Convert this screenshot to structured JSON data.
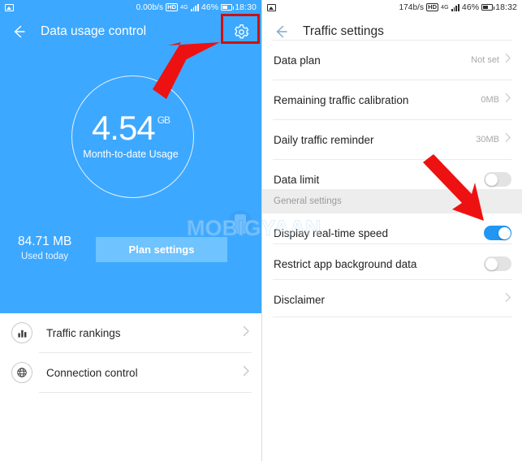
{
  "left": {
    "status": {
      "photo_icon": "photo-icon",
      "speed": "0.00b/s",
      "hd": "HD",
      "net": "4G",
      "battery_pct": "46%",
      "time": "18:30"
    },
    "appbar": {
      "back_icon": "back-arrow-icon",
      "title": "Data usage control",
      "settings_icon": "gear-icon"
    },
    "usage": {
      "value": "4.54",
      "unit": "GB",
      "caption": "Month-to-date Usage",
      "today_value": "84.71 MB",
      "today_caption": "Used today",
      "plan_button": "Plan settings"
    },
    "rows": [
      {
        "label": "Traffic rankings",
        "icon": "bar-chart-icon"
      },
      {
        "label": "Connection control",
        "icon": "globe-icon"
      }
    ]
  },
  "right": {
    "status": {
      "photo_icon": "photo-icon",
      "speed": "174b/s",
      "hd": "HD",
      "net": "4G",
      "battery_pct": "46%",
      "time": "18:32"
    },
    "appbar": {
      "back_icon": "back-arrow-icon",
      "title": "Traffic settings"
    },
    "rows": [
      {
        "label": "Data plan",
        "value": "Not set",
        "type": "chevron"
      },
      {
        "label": "Remaining traffic calibration",
        "value": "0MB",
        "type": "chevron"
      },
      {
        "label": "Daily traffic reminder",
        "value": "30MB",
        "type": "chevron"
      },
      {
        "label": "Data limit",
        "value": "",
        "type": "toggle",
        "state": "off"
      }
    ],
    "section_header": "General settings",
    "rows2": [
      {
        "label": "Display real-time speed",
        "value": "",
        "type": "toggle",
        "state": "on"
      },
      {
        "label": "Restrict app background data",
        "value": "",
        "type": "toggle",
        "state": "off"
      },
      {
        "label": "Disclaimer",
        "value": "",
        "type": "chevron"
      }
    ]
  },
  "annotations": {
    "highlight_box_target": "gear-icon",
    "arrow_left_target": "gear-icon",
    "arrow_right_target": "display-real-time-speed-toggle"
  },
  "watermark": {
    "text": "MOBIGYAAN"
  },
  "colors": {
    "brand_blue": "#3da8ff",
    "button_blue": "#6fc3ff",
    "toggle_on": "#2196f3",
    "toggle_off": "#e3e3e3",
    "annotation_red": "#ee1111",
    "highlight_red": "#cc1111",
    "section_bg": "#ededed"
  }
}
